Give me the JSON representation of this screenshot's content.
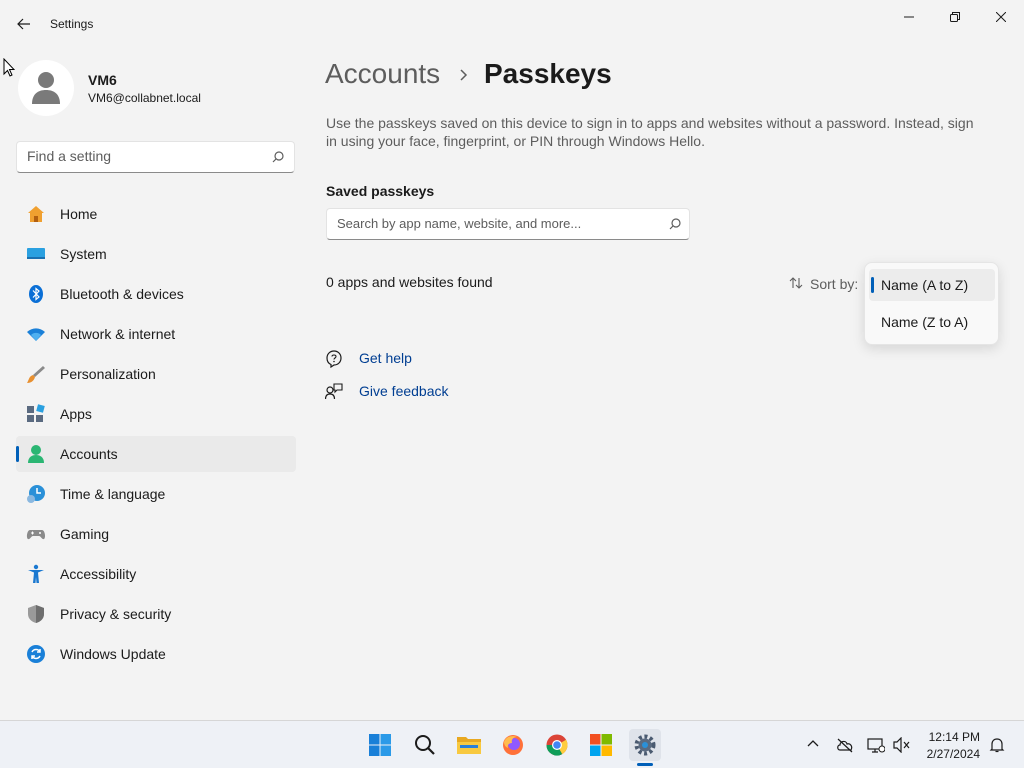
{
  "window": {
    "title": "Settings"
  },
  "user": {
    "name": "VM6",
    "email": "VM6@collabnet.local"
  },
  "search": {
    "placeholder": "Find a setting"
  },
  "nav": {
    "items": [
      {
        "label": "Home",
        "icon": "home-icon"
      },
      {
        "label": "System",
        "icon": "system-icon"
      },
      {
        "label": "Bluetooth & devices",
        "icon": "bluetooth-icon"
      },
      {
        "label": "Network & internet",
        "icon": "network-icon"
      },
      {
        "label": "Personalization",
        "icon": "personalization-icon"
      },
      {
        "label": "Apps",
        "icon": "apps-icon"
      },
      {
        "label": "Accounts",
        "icon": "accounts-icon",
        "active": true
      },
      {
        "label": "Time & language",
        "icon": "time-language-icon"
      },
      {
        "label": "Gaming",
        "icon": "gaming-icon"
      },
      {
        "label": "Accessibility",
        "icon": "accessibility-icon"
      },
      {
        "label": "Privacy & security",
        "icon": "shield-icon"
      },
      {
        "label": "Windows Update",
        "icon": "update-icon"
      }
    ]
  },
  "main": {
    "breadcrumb_parent": "Accounts",
    "title": "Passkeys",
    "description": "Use the passkeys saved on this device to sign in to apps and websites without a password. Instead, sign in using your face, fingerprint, or PIN through Windows Hello.",
    "section_title": "Saved passkeys",
    "search_placeholder": "Search by app name, website, and more...",
    "found_text": "0 apps and websites found",
    "sort_label": "Sort by:",
    "sort_options": [
      "Name (A to Z)",
      "Name (Z to A)"
    ],
    "sort_selected": "Name (A to Z)",
    "help_links": [
      "Get help",
      "Give feedback"
    ]
  },
  "taskbar": {
    "time": "12:14 PM",
    "date": "2/27/2024"
  },
  "colors": {
    "accent": "#005fb8",
    "link": "#003e92",
    "background": "#f3f3f3"
  }
}
